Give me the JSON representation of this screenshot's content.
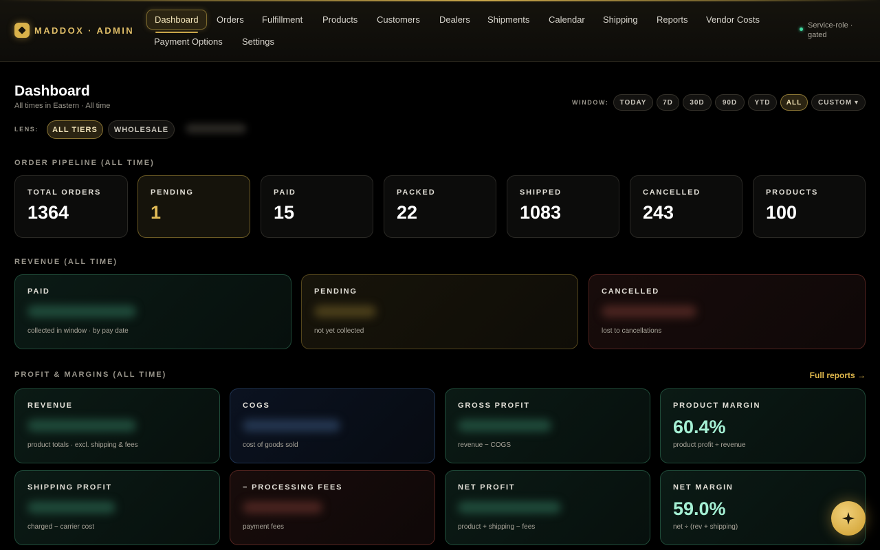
{
  "brand": {
    "name": "MADDOX · ADMIN"
  },
  "nav": {
    "items": [
      {
        "label": "Dashboard",
        "active": true
      },
      {
        "label": "Orders"
      },
      {
        "label": "Fulfillment"
      },
      {
        "label": "Products"
      },
      {
        "label": "Customers"
      },
      {
        "label": "Dealers"
      },
      {
        "label": "Shipments"
      },
      {
        "label": "Calendar"
      },
      {
        "label": "Shipping"
      },
      {
        "label": "Reports"
      },
      {
        "label": "Vendor Costs"
      },
      {
        "label": "Payment Options"
      },
      {
        "label": "Settings"
      }
    ]
  },
  "session": {
    "text": "Service-role · gated"
  },
  "page": {
    "title": "Dashboard",
    "subtitle": "All times in Eastern · All time"
  },
  "window": {
    "label": "WINDOW:",
    "options": [
      "TODAY",
      "7D",
      "30D",
      "90D",
      "YTD",
      "ALL",
      "CUSTOM ▾"
    ],
    "selected": "ALL"
  },
  "lens": {
    "label": "LENS:",
    "options": [
      "ALL TIERS",
      "WHOLESALE"
    ],
    "selected": "ALL TIERS"
  },
  "pipeline": {
    "title": "ORDER PIPELINE (ALL TIME)",
    "cards": [
      {
        "label": "TOTAL ORDERS",
        "value": "1364"
      },
      {
        "label": "PENDING",
        "value": "1"
      },
      {
        "label": "PAID",
        "value": "15"
      },
      {
        "label": "PACKED",
        "value": "22"
      },
      {
        "label": "SHIPPED",
        "value": "1083"
      },
      {
        "label": "CANCELLED",
        "value": "243"
      },
      {
        "label": "PRODUCTS",
        "value": "100"
      }
    ]
  },
  "revenue": {
    "title": "REVENUE (ALL TIME)",
    "cards": [
      {
        "label": "PAID",
        "hint": "collected in window · by pay date"
      },
      {
        "label": "PENDING",
        "hint": "not yet collected"
      },
      {
        "label": "CANCELLED",
        "hint": "lost to cancellations"
      }
    ]
  },
  "profit": {
    "title": "PROFIT & MARGINS (ALL TIME)",
    "link": "Full reports →",
    "cards": [
      {
        "label": "REVENUE",
        "hint": "product totals · excl. shipping & fees"
      },
      {
        "label": "COGS",
        "hint": "cost of goods sold"
      },
      {
        "label": "GROSS PROFIT",
        "hint": "revenue − COGS"
      },
      {
        "label": "PRODUCT MARGIN",
        "value": "60.4%",
        "hint": "product profit ÷ revenue"
      },
      {
        "label": "SHIPPING PROFIT",
        "hint": "charged − carrier cost"
      },
      {
        "label": "− PROCESSING FEES",
        "hint": "payment fees"
      },
      {
        "label": "NET PROFIT",
        "hint": "product + shipping − fees"
      },
      {
        "label": "NET MARGIN",
        "value": "59.0%",
        "hint": "net ÷ (rev + shipping)"
      }
    ]
  },
  "fab": {
    "icon": "sparkle-icon"
  },
  "colors": {
    "accent": "#d9b24a",
    "positive": "#a5f0d4",
    "background": "#000000"
  }
}
